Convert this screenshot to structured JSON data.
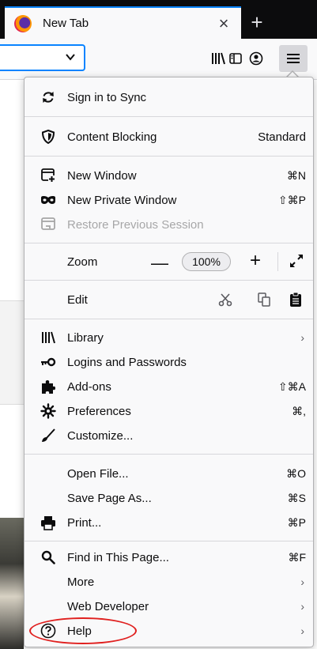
{
  "tab": {
    "title": "New Tab"
  },
  "menu": {
    "sync": "Sign in to Sync",
    "content_blocking": {
      "label": "Content Blocking",
      "value": "Standard"
    },
    "new_window": {
      "label": "New Window",
      "shortcut": "⌘N"
    },
    "new_private_window": {
      "label": "New Private Window",
      "shortcut": "⇧⌘P"
    },
    "restore_session": "Restore Previous Session",
    "zoom": {
      "label": "Zoom",
      "value": "100%"
    },
    "edit": "Edit",
    "library": "Library",
    "logins": "Logins and Passwords",
    "addons": {
      "label": "Add-ons",
      "shortcut": "⇧⌘A"
    },
    "preferences": {
      "label": "Preferences",
      "shortcut": "⌘,"
    },
    "customize": "Customize...",
    "open_file": {
      "label": "Open File...",
      "shortcut": "⌘O"
    },
    "save_page": {
      "label": "Save Page As...",
      "shortcut": "⌘S"
    },
    "print": {
      "label": "Print...",
      "shortcut": "⌘P"
    },
    "find": {
      "label": "Find in This Page...",
      "shortcut": "⌘F"
    },
    "more": "More",
    "web_developer": "Web Developer",
    "help": "Help",
    "chevron": "›"
  },
  "colors": {
    "accent": "#0a84ff",
    "highlight": "#e0201f",
    "menu_bg": "#f9f9fa"
  }
}
